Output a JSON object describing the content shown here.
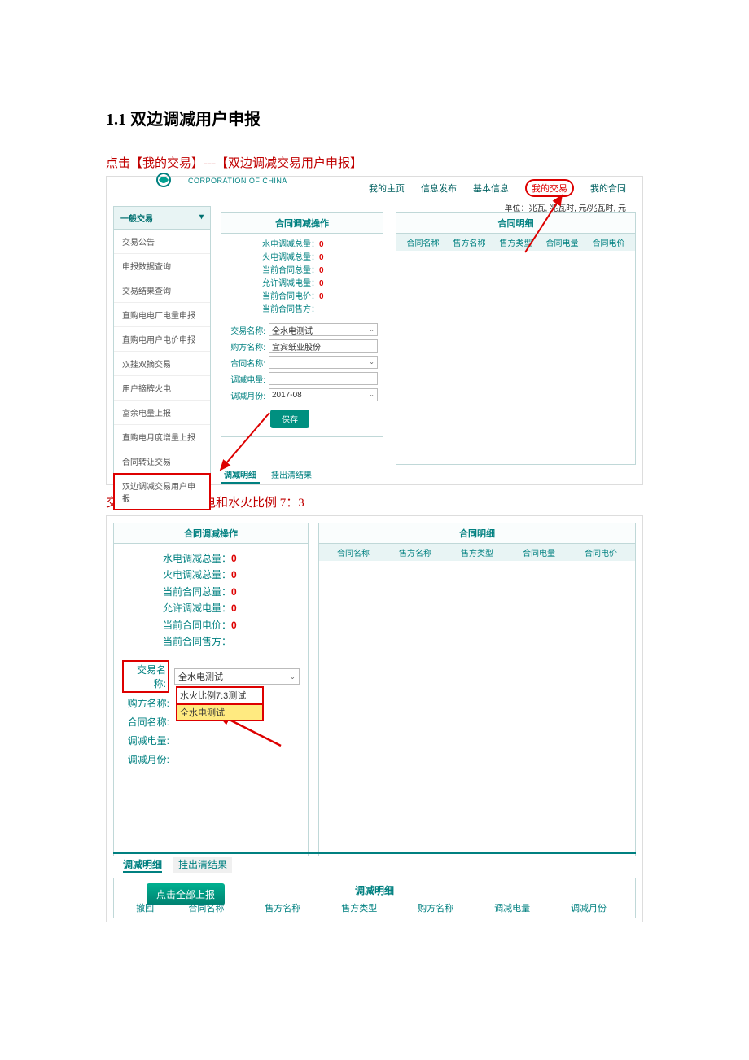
{
  "doc": {
    "heading": "1.1 双边调减用户申报",
    "instruction1": "点击【我的交易】---【双边调减交易用户申报】",
    "instruction2": "交易名称：分全水电和水火比例 7：3"
  },
  "topbar": {
    "logo_sub": "CORPORATION OF CHINA",
    "nav": [
      "我的主页",
      "信息发布",
      "基本信息",
      "我的交易",
      "我的合同"
    ],
    "unit": "单位：兆瓦, 兆瓦时, 元/兆瓦时, 元"
  },
  "sidebar": {
    "header": "一般交易",
    "items": [
      "交易公告",
      "申报数据查询",
      "交易结果查询",
      "直购电电厂电量申报",
      "直购电用户电价申报",
      "双挂双摘交易",
      "用户摘牌火电",
      "富余电量上报",
      "直购电月度增量上报",
      "合同转让交易",
      "双边调减交易用户申报"
    ]
  },
  "panel_op": {
    "title": "合同调减操作",
    "stats": [
      {
        "label": "水电调减总量：",
        "value": "0"
      },
      {
        "label": "火电调减总量：",
        "value": "0"
      },
      {
        "label": "当前合同总量：",
        "value": "0"
      },
      {
        "label": "允许调减电量：",
        "value": "0"
      },
      {
        "label": "当前合同电价：",
        "value": "0"
      },
      {
        "label": "当前合同售方：",
        "value": ""
      }
    ],
    "form": {
      "trade_name_label": "交易名称:",
      "trade_name_value": "全水电测试",
      "buyer_label": "购方名称:",
      "buyer_value": "宜宾纸业股份",
      "contract_label": "合同名称:",
      "contract_value": "",
      "reduce_qty_label": "调减电量:",
      "reduce_qty_value": "",
      "reduce_month_label": "调减月份:",
      "reduce_month_value": "2017-08",
      "save": "保存"
    }
  },
  "panel_detail": {
    "title": "合同明细",
    "cols": [
      "合同名称",
      "售方名称",
      "售方类型",
      "合同电量",
      "合同电价"
    ]
  },
  "tabs_bottom": [
    "调减明细",
    "挂出清结果"
  ],
  "shot2": {
    "dropdown": {
      "current": "全水电测试",
      "options": [
        "水火比例7:3测试",
        "全水电测试"
      ]
    }
  },
  "upload": {
    "button": "点击全部上报",
    "title": "调减明细",
    "cols": [
      "撤回",
      "合同名称",
      "售方名称",
      "售方类型",
      "购方名称",
      "调减电量",
      "调减月份"
    ]
  }
}
